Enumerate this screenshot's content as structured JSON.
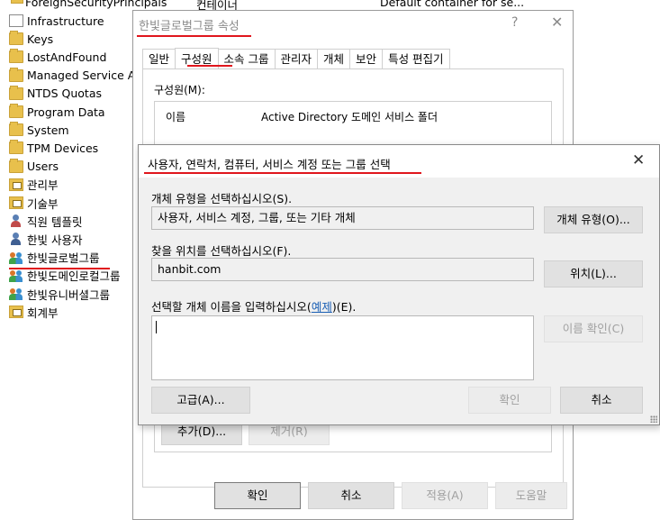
{
  "top_row": {
    "name": "ForeignSecurityPrincipals",
    "type": "컨테이너",
    "description": "Default container for se..."
  },
  "tree": {
    "items": [
      {
        "label": "Infrastructure",
        "icon": "document-icon",
        "kind": "doc"
      },
      {
        "label": "Keys",
        "icon": "folder-icon",
        "kind": "folder"
      },
      {
        "label": "LostAndFound",
        "icon": "folder-icon",
        "kind": "folder"
      },
      {
        "label": "Managed Service Ac",
        "icon": "folder-icon",
        "kind": "folder"
      },
      {
        "label": "NTDS Quotas",
        "icon": "folder-icon",
        "kind": "folder"
      },
      {
        "label": "Program Data",
        "icon": "folder-icon",
        "kind": "folder"
      },
      {
        "label": "System",
        "icon": "folder-icon",
        "kind": "folder"
      },
      {
        "label": "TPM Devices",
        "icon": "folder-icon",
        "kind": "folder"
      },
      {
        "label": "Users",
        "icon": "folder-icon",
        "kind": "folder"
      },
      {
        "label": "관리부",
        "icon": "ou-icon",
        "kind": "ou"
      },
      {
        "label": "기술부",
        "icon": "ou-icon",
        "kind": "ou"
      },
      {
        "label": "직원 템플릿",
        "icon": "user-template-icon",
        "kind": "tpl"
      },
      {
        "label": "한빛 사용자",
        "icon": "user-icon",
        "kind": "user"
      },
      {
        "label": "한빛글로벌그룹",
        "icon": "group-icon",
        "kind": "grp"
      },
      {
        "label": "한빛도메인로컬그룹",
        "icon": "group-icon",
        "kind": "grp"
      },
      {
        "label": "한빛유니버셜그룹",
        "icon": "group-icon",
        "kind": "grp"
      },
      {
        "label": "회계부",
        "icon": "ou-icon",
        "kind": "ou"
      }
    ]
  },
  "properties": {
    "title": "한빛글로벌그룹 속성",
    "help_glyph": "?",
    "close_glyph": "✕",
    "tabs": [
      "일반",
      "구성원",
      "소속 그룹",
      "관리자",
      "개체",
      "보안",
      "특성 편집기"
    ],
    "active_tab": "구성원",
    "members_label": "구성원(M):",
    "columns": {
      "name": "이름",
      "value": "Active Directory 도메인 서비스 폴더"
    },
    "add_button": "추가(D)...",
    "remove_button": "제거(R)",
    "ok_button": "확인",
    "cancel_button": "취소",
    "apply_button": "적용(A)",
    "help_button": "도움말"
  },
  "select_dialog": {
    "title": "사용자, 연락처, 컴퓨터, 서비스 계정 또는 그룹 선택",
    "close_glyph": "✕",
    "object_type_label": "개체 유형을 선택하십시오(S).",
    "object_type_value": "사용자, 서비스 계정, 그룹, 또는 기타 개체",
    "object_type_button": "개체 유형(O)...",
    "location_label": "찾을 위치를 선택하십시오(F).",
    "location_value": "hanbit.com",
    "location_button": "위치(L)...",
    "enter_names_label": "선택할 개체 이름을 입력하십시오(",
    "examples_link": "예제",
    "enter_names_suffix": ")(E).",
    "names_value": "",
    "check_names_button": "이름 확인(C)",
    "advanced_button": "고급(A)...",
    "ok_button": "확인",
    "cancel_button": "취소"
  },
  "annotation_color": "#e0161d"
}
